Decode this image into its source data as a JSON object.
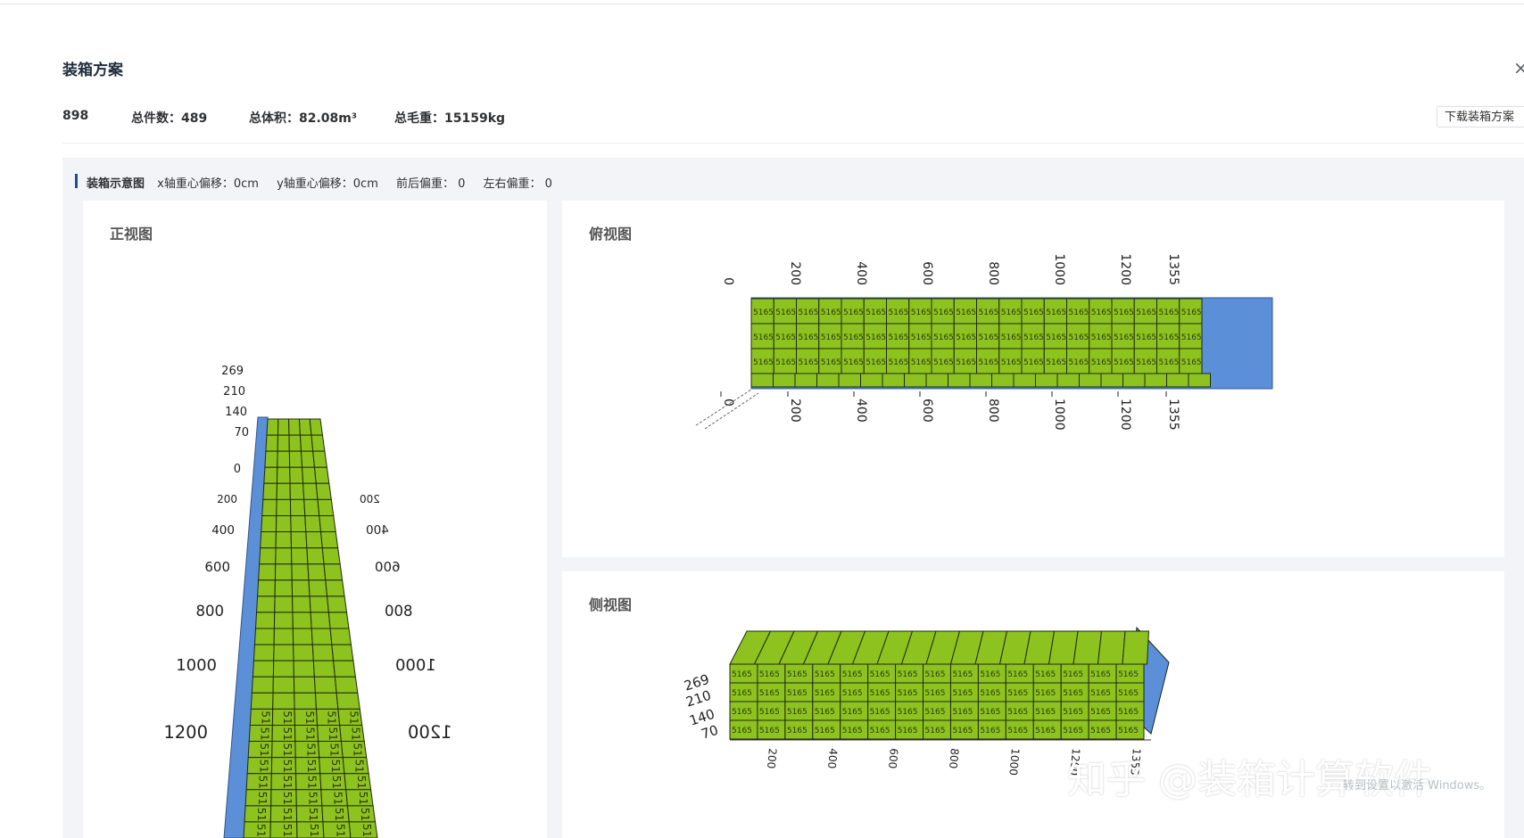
{
  "dialog": {
    "title": "装箱方案",
    "close_icon": "×",
    "stats": {
      "count": "898",
      "total_pieces": "总件数：489",
      "total_volume": "总体积：82.08m³",
      "gross_weight": "总毛重：15159kg"
    },
    "download_label": "下载装箱方案"
  },
  "diagram_section": {
    "label": "装箱示意图",
    "x_offset": "x轴重心偏移：0cm",
    "y_offset": "y轴重心偏移：0cm",
    "front_back": "前后偏重：  0",
    "left_right": "左右偏重：  0"
  },
  "views": {
    "front_title": "正视图",
    "top_title": "俯视图",
    "side_title": "侧视图",
    "box_label": "5165",
    "top_box_label": "5165",
    "front_height_ticks": [
      "269",
      "210",
      "140",
      "70",
      "0"
    ],
    "front_depth_ticks": [
      "200",
      "400",
      "600",
      "800",
      "1000",
      "1200"
    ],
    "top_length_ticks": [
      "0",
      "200",
      "400",
      "600",
      "800",
      "1000",
      "1200",
      "1355"
    ],
    "side_height_ticks": [
      "269",
      "210",
      "140",
      "70"
    ],
    "side_length_ticks": [
      "200",
      "400",
      "600",
      "800",
      "1000",
      "1200",
      "1355"
    ]
  },
  "colors": {
    "box_fill": "#8dc21f",
    "box_stroke": "#1e2a12",
    "container_blue": "#5b8fd8",
    "accent_bar": "#1f4e9d"
  },
  "watermark": "知乎 @装箱计算软件",
  "activation_text": "转到设置以激活 Windows。"
}
